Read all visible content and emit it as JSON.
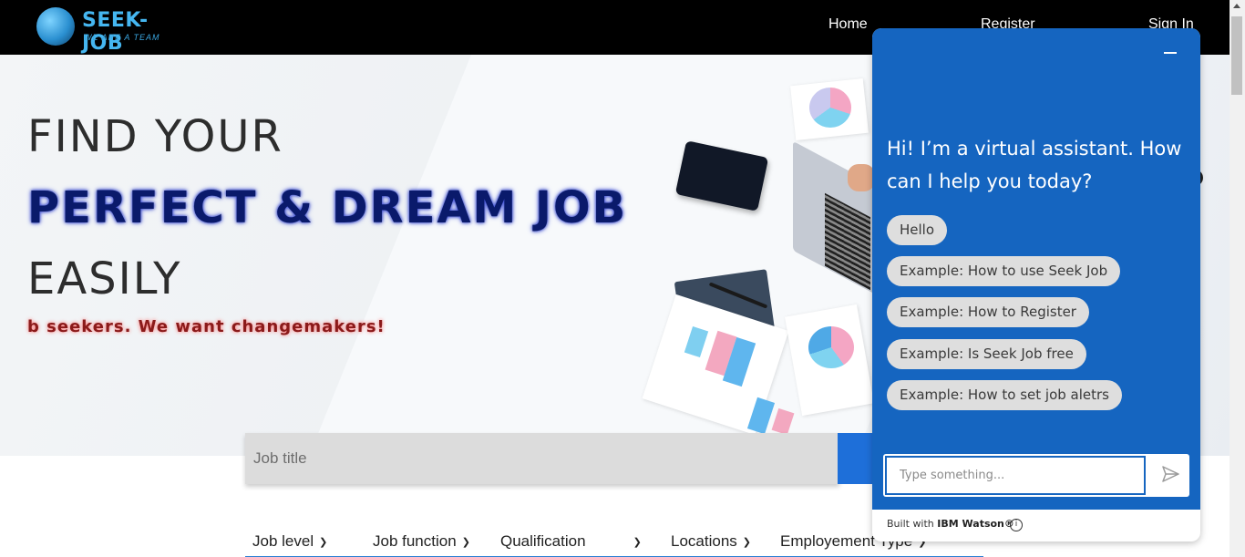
{
  "brand": {
    "name": "SEEK-JOB",
    "tagline": "WE ARE A TEAM"
  },
  "nav": {
    "home": "Home",
    "register": "Register",
    "sign_in": "Sign In"
  },
  "hero": {
    "line1": "FIND YOUR",
    "line2": "PERFECT & DREAM JOB",
    "line3": "EASILY",
    "tagline": "b seekers. We want changemakers!"
  },
  "search": {
    "placeholder": "Job title"
  },
  "filters": [
    {
      "label": "Job level"
    },
    {
      "label": "Job function"
    },
    {
      "label": "Qualification"
    },
    {
      "label": "Locations"
    },
    {
      "label": "Employement Type"
    }
  ],
  "chat": {
    "greeting": "Hi! I’m a virtual assistant. How can I help you today?",
    "suggestions": [
      "Hello",
      "Example: How to use Seek Job",
      "Example: How to Register",
      "Example: Is Seek Job free",
      "Example: How to set job aletrs"
    ],
    "input_placeholder": "Type something...",
    "footer_prefix": "Built with ",
    "footer_brand": "IBM Watson®"
  },
  "icons": {
    "logo": "globe-runner-icon",
    "minimize": "minimize-icon",
    "send": "send-icon",
    "info": "info-icon",
    "chevron": "chevron-down-icon"
  },
  "colors": {
    "topbar": "#000000",
    "accent": "#1565c0",
    "search_button": "#1e6fd9",
    "chip": "#dedede",
    "hero_highlight": "#0a1a6b"
  }
}
